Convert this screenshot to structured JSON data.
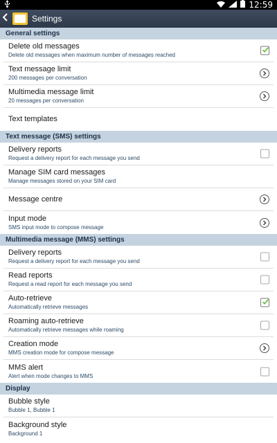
{
  "status_bar": {
    "time": "12:59"
  },
  "action_bar": {
    "title": "Settings"
  },
  "sections": [
    {
      "header": "General settings",
      "rows": [
        {
          "title": "Delete old messages",
          "subtitle": "Delete old messages when maximum number of messages reached",
          "control": "checkbox",
          "checked": true
        },
        {
          "title": "Text message limit",
          "subtitle": "200 messages per conversation",
          "control": "chevron"
        },
        {
          "title": "Multimedia message limit",
          "subtitle": "20 messages per conversation",
          "control": "chevron"
        },
        {
          "title": "Text templates",
          "subtitle": "",
          "control": "none"
        }
      ]
    },
    {
      "header": "Text message (SMS) settings",
      "rows": [
        {
          "title": "Delivery reports",
          "subtitle": "Request a delivery report for each message you send",
          "control": "checkbox",
          "checked": false
        },
        {
          "title": "Manage SIM card messages",
          "subtitle": "Manage messages stored on your SIM card",
          "control": "none"
        },
        {
          "title": "Message centre",
          "subtitle": "",
          "control": "chevron"
        },
        {
          "title": "Input mode",
          "subtitle": "SMS input mode to compose message",
          "control": "chevron"
        }
      ]
    },
    {
      "header": "Multimedia message (MMS) settings",
      "rows": [
        {
          "title": "Delivery reports",
          "subtitle": "Request a delivery report for each message you send",
          "control": "checkbox",
          "checked": false
        },
        {
          "title": "Read reports",
          "subtitle": "Request a read report for each message you send",
          "control": "checkbox",
          "checked": false
        },
        {
          "title": "Auto-retrieve",
          "subtitle": "Automatically retrieve messages",
          "control": "checkbox",
          "checked": true
        },
        {
          "title": "Roaming auto-retrieve",
          "subtitle": "Automatically retrieve messages while roaming",
          "control": "checkbox",
          "checked": false
        },
        {
          "title": "Creation mode",
          "subtitle": "MMS creation mode for compose message",
          "control": "chevron"
        },
        {
          "title": "MMS alert",
          "subtitle": "Alert when mode changes to MMS",
          "control": "checkbox",
          "checked": false
        }
      ]
    },
    {
      "header": "Display",
      "rows": [
        {
          "title": "Bubble style",
          "subtitle": "Bubble 1, Bubble 1",
          "control": "none"
        },
        {
          "title": "Background style",
          "subtitle": "Background 1",
          "control": "none"
        }
      ]
    }
  ],
  "colors": {
    "section_bg": "#c5d3e0",
    "check_green": "#5cb82e",
    "subtitle": "#2c4a66"
  }
}
